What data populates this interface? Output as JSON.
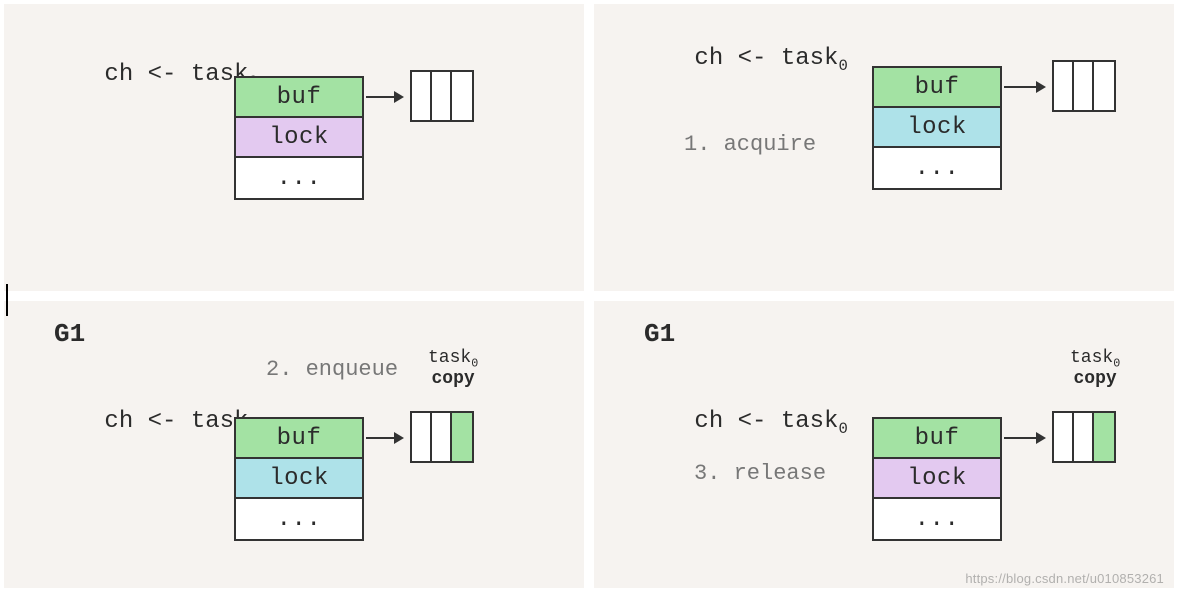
{
  "panels": [
    {
      "code": "ch <- task",
      "codeSub": "0",
      "struct": {
        "rows": [
          "buf",
          "lock",
          "..."
        ],
        "lockColor": "purple"
      },
      "buffer": {
        "slots": 3,
        "filled": []
      }
    },
    {
      "code": "ch <- task",
      "codeSub": "0",
      "anno": "1. acquire",
      "struct": {
        "rows": [
          "buf",
          "lock",
          "..."
        ],
        "lockColor": "blue"
      },
      "buffer": {
        "slots": 3,
        "filled": []
      }
    },
    {
      "g1": "G1",
      "code": "ch <- task",
      "codeSub": "0",
      "anno": "2. enqueue",
      "struct": {
        "rows": [
          "buf",
          "lock",
          "..."
        ],
        "lockColor": "blue"
      },
      "buffer": {
        "slots": 3,
        "filled": [
          2
        ]
      },
      "bufLabel": {
        "line1": "task",
        "sub": "0",
        "line2": "copy"
      }
    },
    {
      "g1": "G1",
      "code": "ch <- task",
      "codeSub": "0",
      "anno": "3. release",
      "struct": {
        "rows": [
          "buf",
          "lock",
          "..."
        ],
        "lockColor": "purple"
      },
      "buffer": {
        "slots": 3,
        "filled": [
          2
        ]
      },
      "bufLabel": {
        "line1": "task",
        "sub": "0",
        "line2": "copy"
      }
    }
  ],
  "watermark": "https://blog.csdn.net/u010853261"
}
